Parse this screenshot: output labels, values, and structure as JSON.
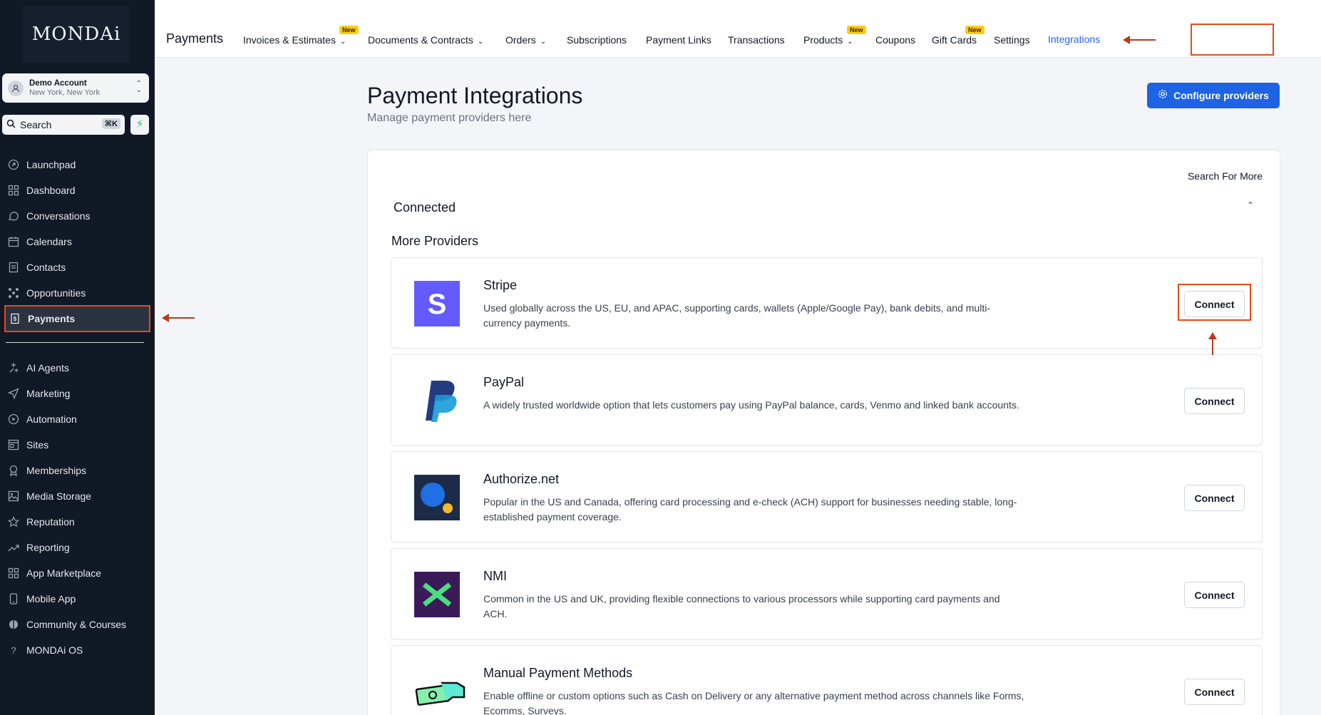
{
  "sidebar": {
    "logo": "MONDAi",
    "account": {
      "name": "Demo Account",
      "location": "New York, New York"
    },
    "search": {
      "label": "Search",
      "shortcut": "⌘K"
    },
    "items": [
      {
        "label": "Launchpad",
        "icon": "rocket-icon"
      },
      {
        "label": "Dashboard",
        "icon": "grid-icon"
      },
      {
        "label": "Conversations",
        "icon": "chat-icon"
      },
      {
        "label": "Calendars",
        "icon": "calendar-icon"
      },
      {
        "label": "Contacts",
        "icon": "contacts-icon"
      },
      {
        "label": "Opportunities",
        "icon": "opportunities-icon"
      },
      {
        "label": "Payments",
        "icon": "payments-icon"
      },
      {
        "label": "AI Agents",
        "icon": "sparkle-icon"
      },
      {
        "label": "Marketing",
        "icon": "send-icon"
      },
      {
        "label": "Automation",
        "icon": "automation-icon"
      },
      {
        "label": "Sites",
        "icon": "sites-icon"
      },
      {
        "label": "Memberships",
        "icon": "membership-icon"
      },
      {
        "label": "Media Storage",
        "icon": "image-icon"
      },
      {
        "label": "Reputation",
        "icon": "star-icon"
      },
      {
        "label": "Reporting",
        "icon": "trend-icon"
      },
      {
        "label": "App Marketplace",
        "icon": "apps-icon"
      },
      {
        "label": "Mobile App",
        "icon": "phone-icon"
      },
      {
        "label": "Community & Courses",
        "icon": "community-icon"
      },
      {
        "label": "MONDAi OS",
        "icon": "question-icon"
      }
    ]
  },
  "topbar": {
    "title": "Payments",
    "tabs": [
      {
        "label": "Invoices & Estimates",
        "badge": "New",
        "dropdown": true
      },
      {
        "label": "Documents & Contracts",
        "dropdown": true
      },
      {
        "label": "Orders",
        "dropdown": true
      },
      {
        "label": "Subscriptions"
      },
      {
        "label": "Payment Links"
      },
      {
        "label": "Transactions"
      },
      {
        "label": "Products",
        "badge": "New",
        "dropdown": true
      },
      {
        "label": "Coupons"
      },
      {
        "label": "Gift Cards",
        "badge": "New"
      },
      {
        "label": "Settings"
      },
      {
        "label": "Integrations",
        "active": true
      }
    ]
  },
  "main": {
    "title": "Payment Integrations",
    "subtitle": "Manage payment providers here",
    "configure_label": "Configure providers",
    "search_more": "Search For More",
    "connected_label": "Connected",
    "more_providers_label": "More Providers",
    "connect_label": "Connect",
    "providers": [
      {
        "name": "Stripe",
        "description": "Used globally across the US, EU, and APAC, supporting cards, wallets (Apple/Google Pay), bank debits, and multi-currency payments."
      },
      {
        "name": "PayPal",
        "description": "A widely trusted worldwide option that lets customers pay using PayPal balance, cards, Venmo and linked bank accounts."
      },
      {
        "name": "Authorize.net",
        "description": "Popular in the US and Canada, offering card processing and e-check (ACH) support for businesses needing stable, long-established payment coverage."
      },
      {
        "name": "NMI",
        "description": "Common in the US and UK, providing flexible connections to various processors while supporting card payments and ACH."
      },
      {
        "name": "Manual Payment Methods",
        "description": "Enable offline or custom options such as Cash on Delivery or any alternative payment method across channels like Forms, Ecomms, Surveys."
      }
    ]
  },
  "colors": {
    "accent": "#1d63e4",
    "sidebar_bg": "#111826",
    "highlight": "#e64a19"
  }
}
